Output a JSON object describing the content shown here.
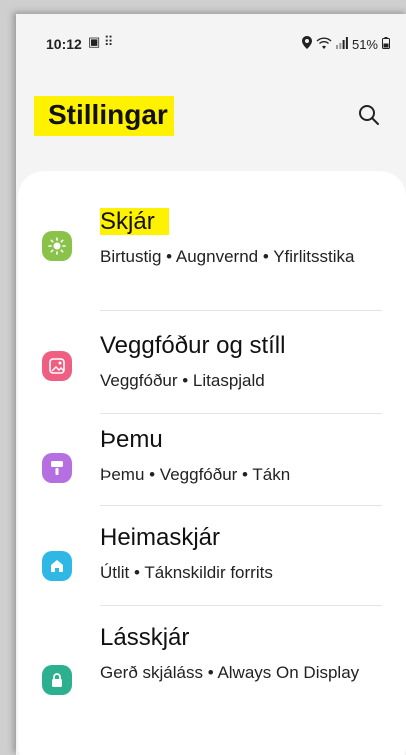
{
  "status_bar": {
    "time": "10:12",
    "notif_icons": "▣ ⠿",
    "battery": "51%"
  },
  "header": {
    "title": "Stillingar"
  },
  "settings": [
    {
      "title": "Skjár",
      "subtitle": "Birtustig • Augnvernd • Yfirlitsstika",
      "icon": "sun-icon",
      "color": "#8bc34a"
    },
    {
      "title": "Veggfóður og stíll",
      "subtitle": "Veggfóður • Litaspjald",
      "icon": "picture-icon",
      "color": "#ef5f82"
    },
    {
      "title": "Þemu",
      "subtitle": "Þemu • Veggfóður • Tákn",
      "icon": "brush-icon",
      "color": "#b56fe0"
    },
    {
      "title": "Heimaskjár",
      "subtitle": "Útlit • Táknskildir forrits",
      "icon": "home-icon",
      "color": "#2fb8e6"
    },
    {
      "title": "Lásskjár",
      "subtitle": "Gerð skjáláss • Always On Display",
      "icon": "lock-icon",
      "color": "#2cb08f"
    }
  ],
  "colors": {
    "highlight": "#fff200"
  }
}
